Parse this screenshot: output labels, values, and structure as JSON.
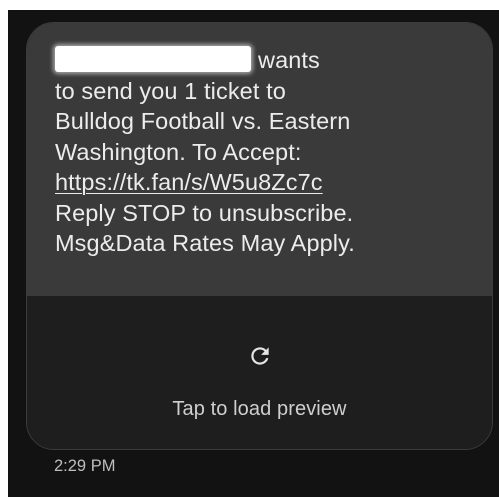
{
  "message": {
    "lines": {
      "line1_suffix": "wants",
      "line2": "to send you 1 ticket to",
      "line3": "Bulldog Football vs. Eastern",
      "line4": "Washington. To Accept:",
      "link": "https://tk.fan/s/W5u8Zc7c",
      "line6": "Reply STOP to unsubscribe.",
      "line7": "Msg&Data Rates May Apply."
    }
  },
  "preview": {
    "icon": "refresh-icon",
    "label": "Tap to load preview"
  },
  "timestamp": "2:29 PM",
  "colors": {
    "background": "#121212",
    "message_bg": "#3a3a3a",
    "preview_bg": "#1e1e1e",
    "text": "#ececec"
  }
}
